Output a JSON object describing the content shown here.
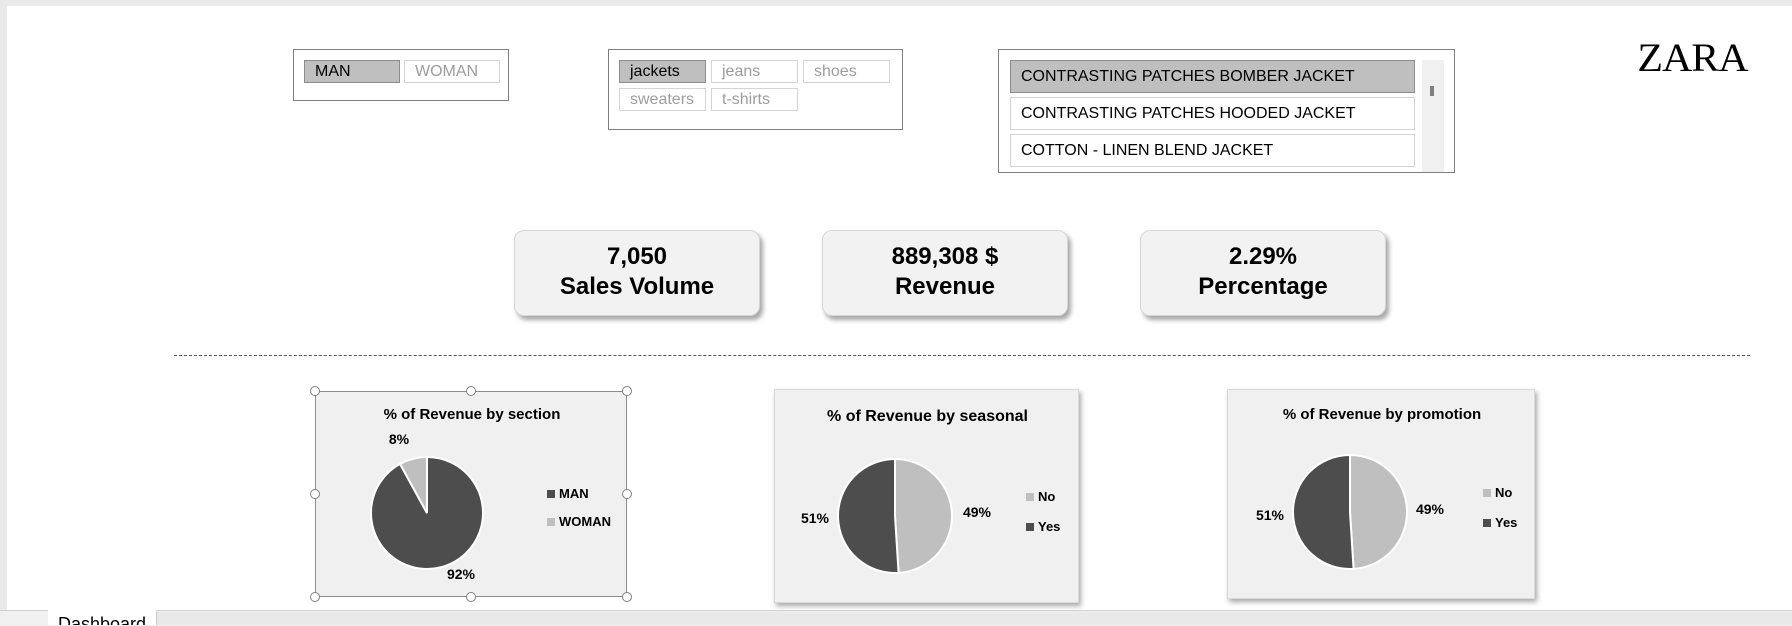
{
  "logo": "ZARA",
  "section_slicer": {
    "items": [
      {
        "label": "MAN",
        "selected": true
      },
      {
        "label": "WOMAN",
        "selected": false
      }
    ]
  },
  "category_slicer": {
    "items": [
      {
        "label": "jackets",
        "selected": true
      },
      {
        "label": "jeans",
        "selected": false
      },
      {
        "label": "shoes",
        "selected": false
      },
      {
        "label": "sweaters",
        "selected": false
      },
      {
        "label": "t-shirts",
        "selected": false
      }
    ]
  },
  "product_slicer": {
    "items": [
      {
        "label": "CONTRASTING PATCHES BOMBER JACKET",
        "selected": true
      },
      {
        "label": "CONTRASTING PATCHES HOODED JACKET",
        "selected": false
      },
      {
        "label": "COTTON - LINEN BLEND JACKET",
        "selected": false
      }
    ]
  },
  "kpis": {
    "sales": {
      "value": "7,050",
      "label": "Sales Volume"
    },
    "revenue": {
      "value": "889,308 $",
      "label": "Revenue"
    },
    "percentage": {
      "value": "2.29%",
      "label": "Percentage"
    }
  },
  "tabs": {
    "active": "Dashboard"
  },
  "chart_data": [
    {
      "type": "pie",
      "title": "% of Revenue by section",
      "categories": [
        "MAN",
        "WOMAN"
      ],
      "values": [
        92,
        8
      ],
      "data_labels": [
        "92%",
        "8%"
      ],
      "colors": [
        "#4d4d4d",
        "#bfbfbf"
      ],
      "legend": "right"
    },
    {
      "type": "pie",
      "title": "% of Revenue by seasonal",
      "categories": [
        "No",
        "Yes"
      ],
      "values": [
        49,
        51
      ],
      "data_labels": [
        "49%",
        "51%"
      ],
      "colors": [
        "#bfbfbf",
        "#4d4d4d"
      ],
      "legend": "right"
    },
    {
      "type": "pie",
      "title": "% of Revenue by promotion",
      "categories": [
        "No",
        "Yes"
      ],
      "values": [
        49,
        51
      ],
      "data_labels": [
        "49%",
        "51%"
      ],
      "colors": [
        "#bfbfbf",
        "#4d4d4d"
      ],
      "legend": "right"
    }
  ]
}
